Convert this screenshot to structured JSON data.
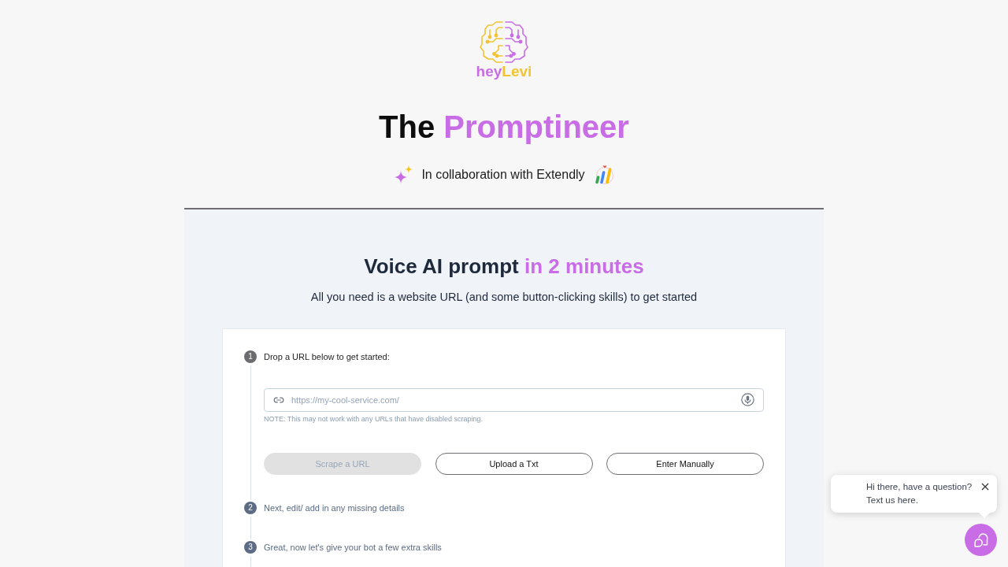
{
  "logo": {
    "prefix": "hey",
    "name": "Levi"
  },
  "title": {
    "text": "The",
    "highlight": "Promptineer"
  },
  "collaboration": {
    "text": "In collaboration with Extendly"
  },
  "panel": {
    "heading": {
      "text": "Voice AI prompt",
      "highlight": "in 2 minutes"
    },
    "subtitle": "All you need is a website URL (and some button-clicking skills) to get started",
    "steps": [
      {
        "number": "1",
        "label": "Drop a URL below to get started:",
        "active": true,
        "url_field": {
          "placeholder": "https://my-cool-service.com/"
        },
        "note": "NOTE: This may not work with any URLs that have disabled scraping.",
        "buttons": [
          {
            "label": "Scrape a URL",
            "disabled": true
          },
          {
            "label": "Upload a Txt",
            "disabled": false
          },
          {
            "label": "Enter Manually",
            "disabled": false
          }
        ]
      },
      {
        "number": "2",
        "label": "Next, edit/ add in any missing details",
        "active": false
      },
      {
        "number": "3",
        "label": "Great, now let's give your bot a few extra skills",
        "active": false
      }
    ]
  },
  "chat": {
    "message": "Hi there, have a question? Text us here."
  }
}
